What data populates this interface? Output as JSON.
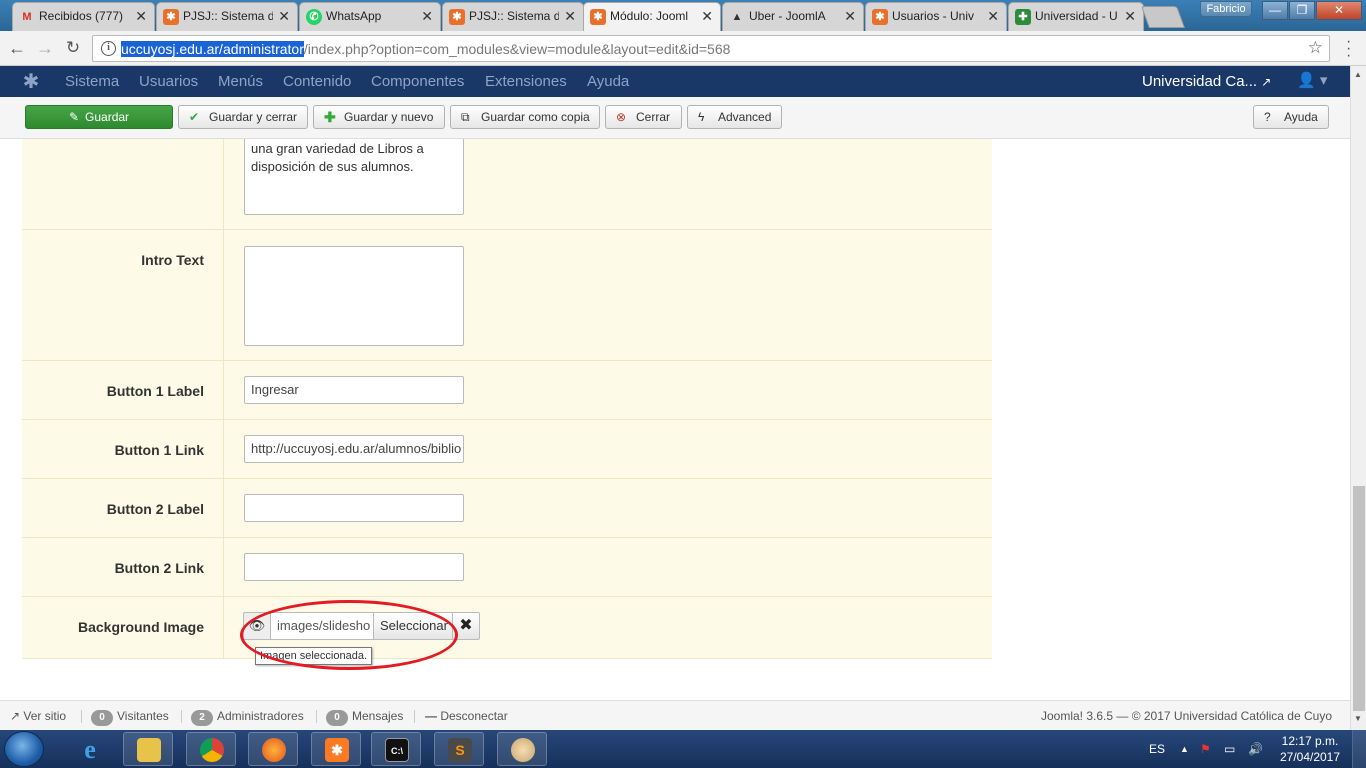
{
  "browser": {
    "tabs": [
      {
        "label": "Recibidos (777)",
        "icon": "gmail-icon",
        "icon_text": "M",
        "icon_color": "#d93025",
        "active": false
      },
      {
        "label": "PJSJ:: Sistema d",
        "icon": "joomla-icon",
        "icon_text": "✱",
        "icon_color": "#e8702a",
        "active": false
      },
      {
        "label": "WhatsApp",
        "icon": "whatsapp-icon",
        "icon_text": "✆",
        "icon_color": "#25d366",
        "active": false
      },
      {
        "label": "PJSJ:: Sistema d",
        "icon": "joomla-icon",
        "icon_text": "✱",
        "icon_color": "#e8702a",
        "active": false
      },
      {
        "label": "Módulo: Jooml",
        "icon": "joomla-icon",
        "icon_text": "✱",
        "icon_color": "#e8702a",
        "active": true
      },
      {
        "label": "Uber - JoomlA",
        "icon": "uber-icon",
        "icon_text": "▲",
        "icon_color": "#333333",
        "active": false
      },
      {
        "label": "Usuarios - Univ",
        "icon": "joomla-icon",
        "icon_text": "✱",
        "icon_color": "#e8702a",
        "active": false
      },
      {
        "label": "Universidad - U",
        "icon": "ucc-icon",
        "icon_text": "✚",
        "icon_color": "#2e8b3a",
        "active": false
      }
    ],
    "close_glyph": "✕",
    "profile_name": "Fabricio",
    "url_highlighted": "uccuyosj.edu.ar/administrator",
    "url_rest": "/index.php?option=com_modules&view=module&layout=edit&id=568"
  },
  "admin_nav": {
    "items": [
      "Sistema",
      "Usuarios",
      "Menús",
      "Contenido",
      "Componentes",
      "Extensiones",
      "Ayuda"
    ],
    "site_name": "Universidad Ca...",
    "user_glyph": "👤 ▾"
  },
  "toolbar": {
    "save": "Guardar",
    "save_close": "Guardar y cerrar",
    "save_new": "Guardar y nuevo",
    "save_copy": "Guardar como copia",
    "close": "Cerrar",
    "advanced": "Advanced",
    "help": "Ayuda"
  },
  "form": {
    "description_value": "una gran variedad de Libros a disposición de sus alumnos.",
    "intro_text_label": "Intro Text",
    "intro_text_value": "",
    "button1_label_label": "Button 1 Label",
    "button1_label_value": "Ingresar",
    "button1_link_label": "Button 1 Link",
    "button1_link_value": "http://uccuyosj.edu.ar/alumnos/biblio",
    "button2_label_label": "Button 2 Label",
    "button2_label_value": "",
    "button2_link_label": "Button 2 Link",
    "button2_link_value": "",
    "background_image_label": "Background Image",
    "background_image_value": "images/slidesho",
    "select_label": "Seleccionar",
    "clear_glyph": "✖",
    "tooltip": "Imagen seleccionada."
  },
  "statusbar": {
    "view_site": "Ver sitio",
    "visitors_count": "0",
    "visitors_label": "Visitantes",
    "admins_count": "2",
    "admins_label": "Administradores",
    "messages_count": "0",
    "messages_label": "Mensajes",
    "logout_label": "Desconectar",
    "footer": "Joomla! 3.6.5  —  © 2017 Universidad Católica de Cuyo"
  },
  "taskbar": {
    "apps": [
      "ie-icon",
      "file-explorer-icon",
      "chrome-icon",
      "firefox-icon",
      "xampp-icon",
      "cmd-icon",
      "sublime-icon",
      "paint-icon"
    ],
    "lang": "ES",
    "time": "12:17 p.m.",
    "date": "27/04/2017"
  },
  "colors": {
    "admin_nav_bg": "#1a3867",
    "save_green": "#46a546",
    "form_row_bg": "#fdfbe8",
    "annotation_red": "#e31b23"
  }
}
